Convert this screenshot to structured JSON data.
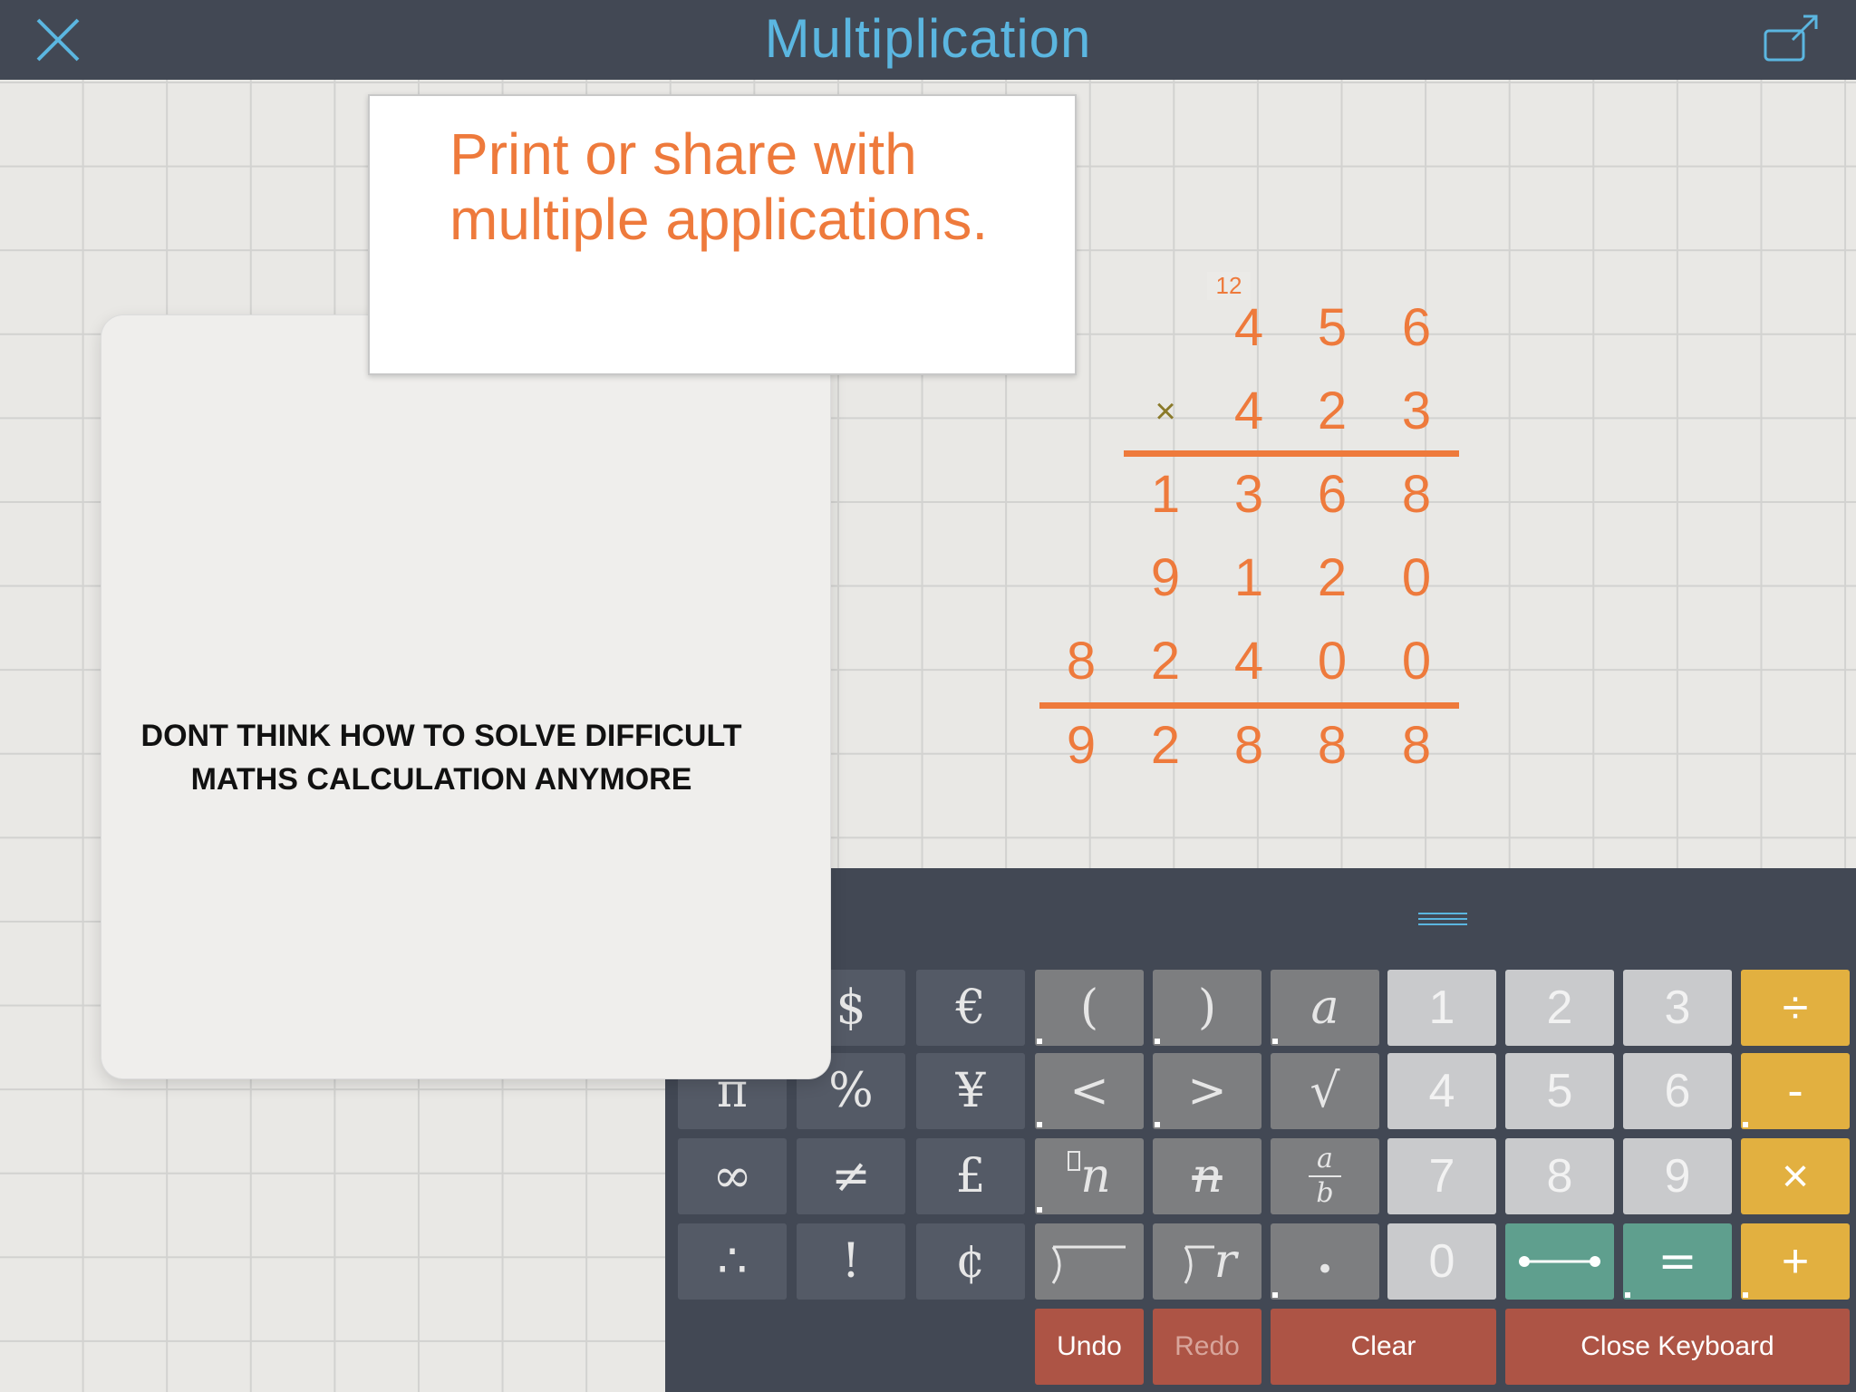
{
  "header": {
    "title": "Multiplication",
    "close_icon": "close-icon",
    "share_icon": "share-icon",
    "accent_color": "#5bb6e0",
    "bar_color": "#424854"
  },
  "promo_banner": {
    "text": "Print or share with multiple applications."
  },
  "info_card": {
    "line1": "DONT THINK HOW TO SOLVE DIFFICULT",
    "line2": "MATHS CALCULATION ANYMORE"
  },
  "worksheet": {
    "carry": "12",
    "multiplicand": [
      "4",
      "5",
      "6"
    ],
    "sign": "×",
    "multiplier": [
      "4",
      "2",
      "3"
    ],
    "partial1": [
      "1",
      "3",
      "6",
      "8"
    ],
    "partial2": [
      "9",
      "1",
      "2",
      "0"
    ],
    "partial3": [
      "8",
      "2",
      "4",
      "0",
      "0"
    ],
    "result": [
      "9",
      "2",
      "8",
      "8",
      "8"
    ],
    "digit_color": "#ee7a3c"
  },
  "keyboard": {
    "row1": [
      "$",
      "€",
      "(",
      ")",
      "a",
      "1",
      "2",
      "3",
      "÷"
    ],
    "row2": [
      "π",
      "%",
      "¥",
      "<",
      ">",
      "√",
      "4",
      "5",
      "6",
      "-"
    ],
    "row3": [
      "∞",
      "≠",
      "£",
      "n",
      "n",
      "a",
      "b",
      "7",
      "8",
      "9",
      "×"
    ],
    "row4": [
      "∴",
      "!",
      "¢",
      "r",
      "•",
      "0",
      "=",
      "+"
    ],
    "actions": {
      "undo": "Undo",
      "redo": "Redo",
      "clear": "Clear",
      "close": "Close Keyboard"
    }
  }
}
